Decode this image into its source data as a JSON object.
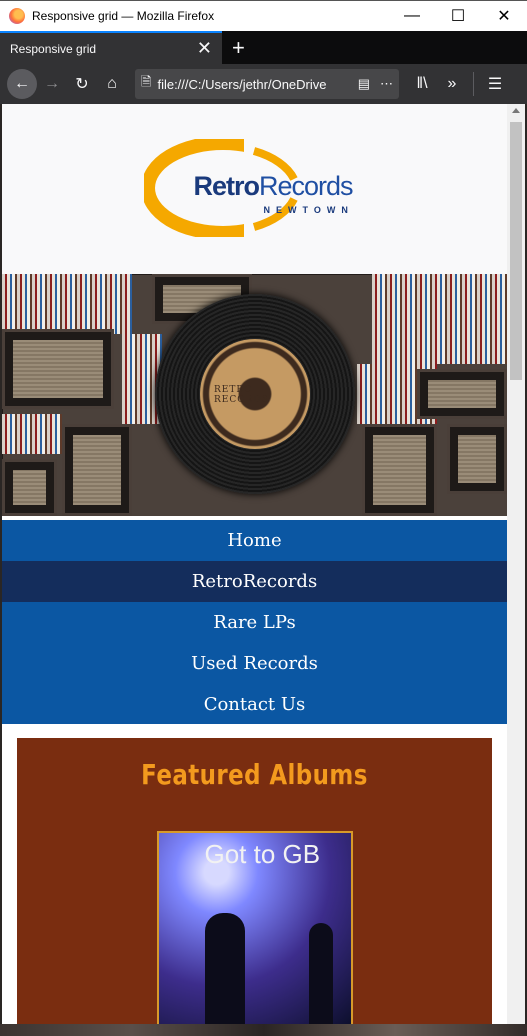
{
  "window": {
    "title": "Responsive grid — Mozilla Firefox"
  },
  "tab": {
    "label": "Responsive grid"
  },
  "urlbar": {
    "value": "file:///C:/Users/jethr/OneDrive"
  },
  "site": {
    "logo": {
      "brand_bold": "Retro",
      "brand_rest": "Records",
      "subtitle": "NEWTOWN"
    },
    "record_label_text": "RETRO RECORDS",
    "nav": [
      {
        "label": "Home"
      },
      {
        "label": "RetroRecords",
        "active": true
      },
      {
        "label": "Rare LPs"
      },
      {
        "label": "Used Records"
      },
      {
        "label": "Contact Us"
      }
    ],
    "featured": {
      "heading": "Featured Albums",
      "album_title": "Got to GB"
    }
  },
  "colors": {
    "nav": "#0b57a3",
    "nav_active": "#142d5c",
    "featured_bg": "#7a2d10",
    "heading": "#f39a1e",
    "logo_ring": "#f5a800",
    "logo_text": "#1a3a7c"
  },
  "icons": {
    "back": "arrow-left-icon",
    "forward": "arrow-right-icon",
    "reload": "reload-icon",
    "home": "home-icon",
    "page": "page-icon",
    "reader": "reader-view-icon",
    "more": "ellipsis-icon",
    "library": "library-icon",
    "overflow": "chevrons-right-icon",
    "menu": "hamburger-icon"
  }
}
